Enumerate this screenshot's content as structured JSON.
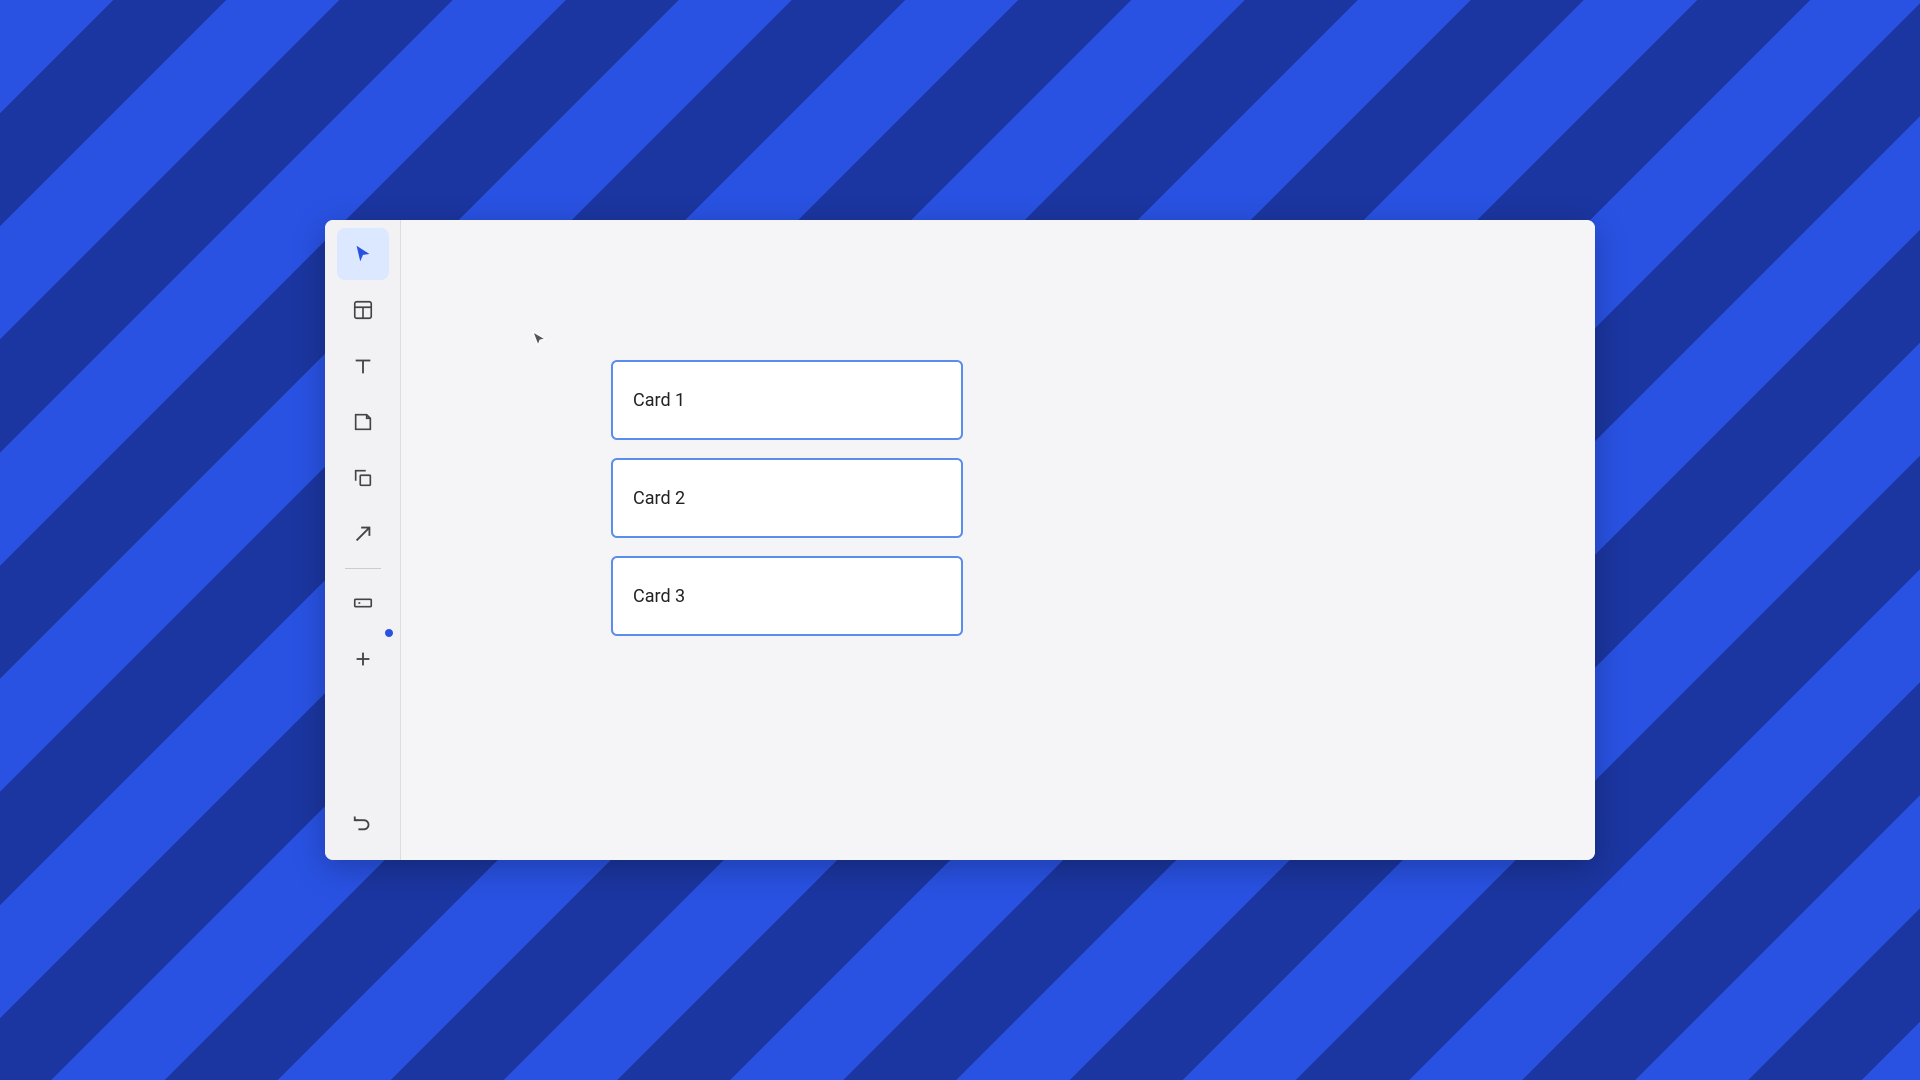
{
  "sidebar": {
    "items": [
      {
        "id": "select",
        "label": "Select",
        "active": true
      },
      {
        "id": "layout",
        "label": "Layout"
      },
      {
        "id": "text",
        "label": "Text"
      },
      {
        "id": "note",
        "label": "Note"
      },
      {
        "id": "shape",
        "label": "Shape"
      },
      {
        "id": "arrow",
        "label": "Arrow"
      },
      {
        "id": "input",
        "label": "Input"
      },
      {
        "id": "add",
        "label": "Add"
      }
    ],
    "bottom_items": [
      {
        "id": "undo",
        "label": "Undo"
      }
    ]
  },
  "canvas": {
    "cards": [
      {
        "id": "card-1",
        "label": "Card 1"
      },
      {
        "id": "card-2",
        "label": "Card 2"
      },
      {
        "id": "card-3",
        "label": "Card 3"
      }
    ]
  },
  "colors": {
    "accent": "#2952e3",
    "card_border": "#5b8dee",
    "active_bg": "#dce8ff"
  }
}
